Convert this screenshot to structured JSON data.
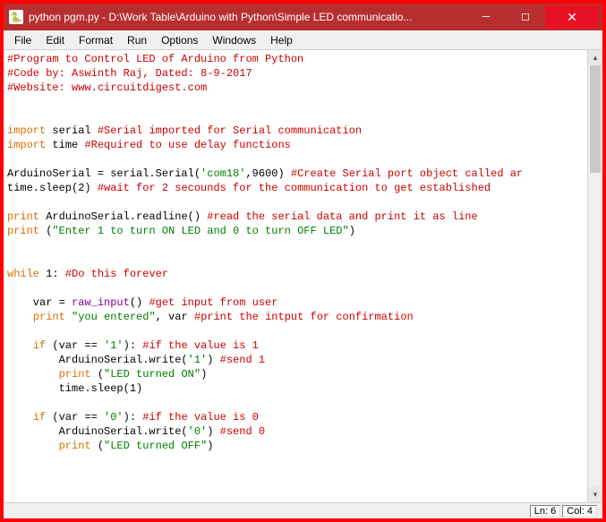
{
  "window": {
    "title": "python pgm.py - D:\\Work Table\\Arduino with Python\\Simple LED communicatio..."
  },
  "menu": {
    "file": "File",
    "edit": "Edit",
    "format": "Format",
    "run": "Run",
    "options": "Options",
    "windows": "Windows",
    "help": "Help"
  },
  "code": {
    "l1": "#Program to Control LED of Arduino from Python",
    "l2": "#Code by: Aswinth Raj, Dated: 8-9-2017",
    "l3": "#Website: www.circuitdigest.com",
    "l4_kw": "import",
    "l4_mod": " serial ",
    "l4_cmt": "#Serial imported for Serial communication",
    "l5_kw": "import",
    "l5_mod": " time ",
    "l5_cmt": "#Required to use delay functions",
    "l6a": "ArduinoSerial = serial.Serial(",
    "l6b": "'com18'",
    "l6c": ",9600) ",
    "l6d": "#Create Serial port object called ar",
    "l7a": "time.sleep(2) ",
    "l7b": "#wait for 2 secounds for the communication to get established",
    "l8_kw": "print",
    "l8a": " ArduinoSerial.readline() ",
    "l8b": "#read the serial data and print it as line",
    "l9_kw": "print",
    "l9a": " (",
    "l9b": "\"Enter 1 to turn ON LED and 0 to turn OFF LED\"",
    "l9c": ")",
    "l10_kw": "while",
    "l10a": " 1: ",
    "l10b": "#Do this forever",
    "l11a": "    var = ",
    "l11b": "raw_input",
    "l11c": "() ",
    "l11d": "#get input from user",
    "l12a": "    ",
    "l12_kw": "print",
    "l12b": " ",
    "l12c": "\"you entered\"",
    "l12d": ", var ",
    "l12e": "#print the intput for confirmation",
    "l13a": "    ",
    "l13_kw": "if",
    "l13b": " (var == ",
    "l13c": "'1'",
    "l13d": "): ",
    "l13e": "#if the value is 1",
    "l14a": "        ArduinoSerial.write(",
    "l14b": "'1'",
    "l14c": ") ",
    "l14d": "#send 1",
    "l15a": "        ",
    "l15_kw": "print",
    "l15b": " (",
    "l15c": "\"LED turned ON\"",
    "l15d": ")",
    "l16a": "        time.sleep(1)",
    "l17a": "    ",
    "l17_kw": "if",
    "l17b": " (var == ",
    "l17c": "'0'",
    "l17d": "): ",
    "l17e": "#if the value is 0",
    "l18a": "        ArduinoSerial.write(",
    "l18b": "'0'",
    "l18c": ") ",
    "l18d": "#send 0",
    "l19a": "        ",
    "l19_kw": "print",
    "l19b": " (",
    "l19c": "\"LED turned OFF\"",
    "l19d": ")"
  },
  "status": {
    "line": "Ln: 6",
    "col": "Col: 4"
  }
}
